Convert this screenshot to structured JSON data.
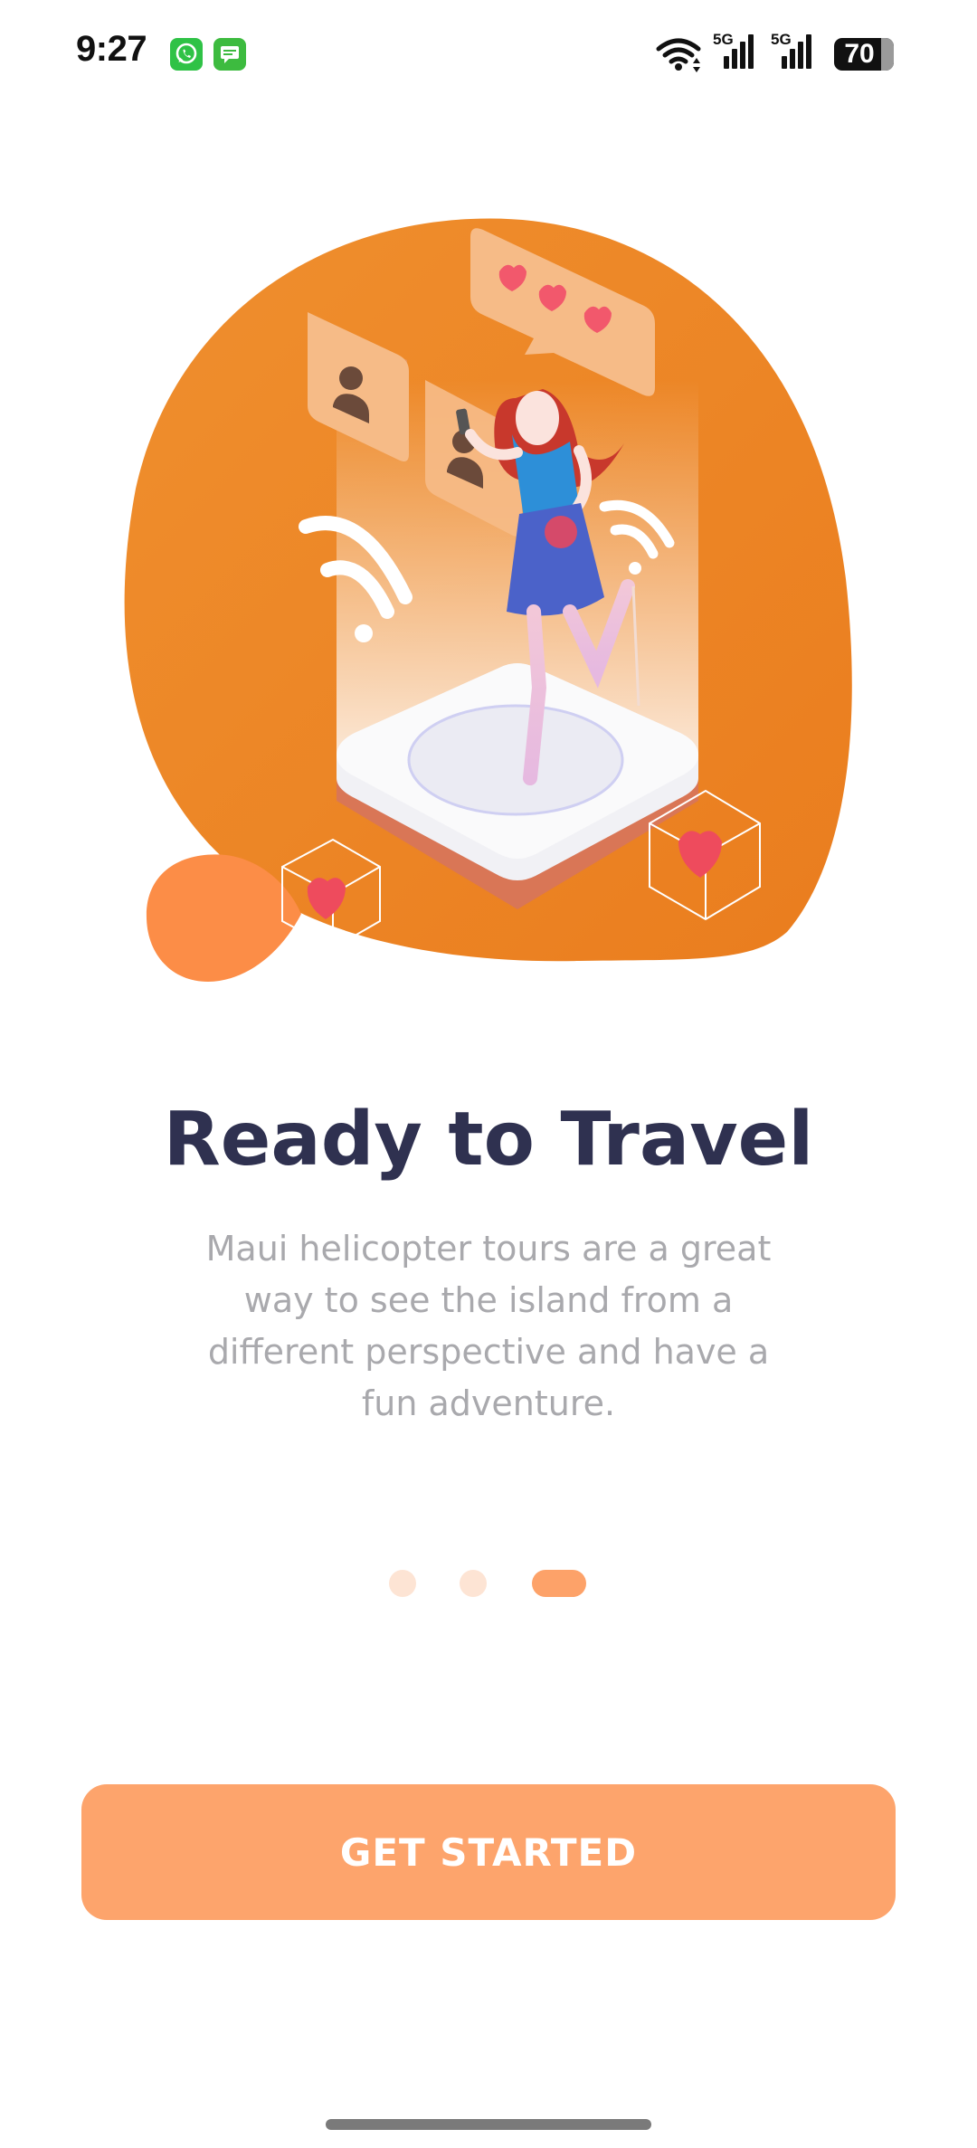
{
  "status_bar": {
    "time": "9:27",
    "battery_level": "70",
    "network_label_1": "5G",
    "network_label_2": "5G",
    "icons": [
      "whatsapp-icon",
      "messages-icon",
      "wifi-icon",
      "signal-icon",
      "signal-icon",
      "battery-icon"
    ]
  },
  "onboarding": {
    "title": "Ready to Travel",
    "description": "Maui helicopter tours are a great way to see the island from a different perspective and have a fun adventure.",
    "page_count": 3,
    "active_page": 3
  },
  "actions": {
    "get_started_label": "GET STARTED"
  },
  "colors": {
    "accent": "#FDA46C",
    "illustration_orange": "#EE8A2C",
    "title": "#2F3150",
    "description": "#A9A9AD",
    "dot_inactive": "#FDE4D4",
    "dot_active": "#FDA269"
  }
}
